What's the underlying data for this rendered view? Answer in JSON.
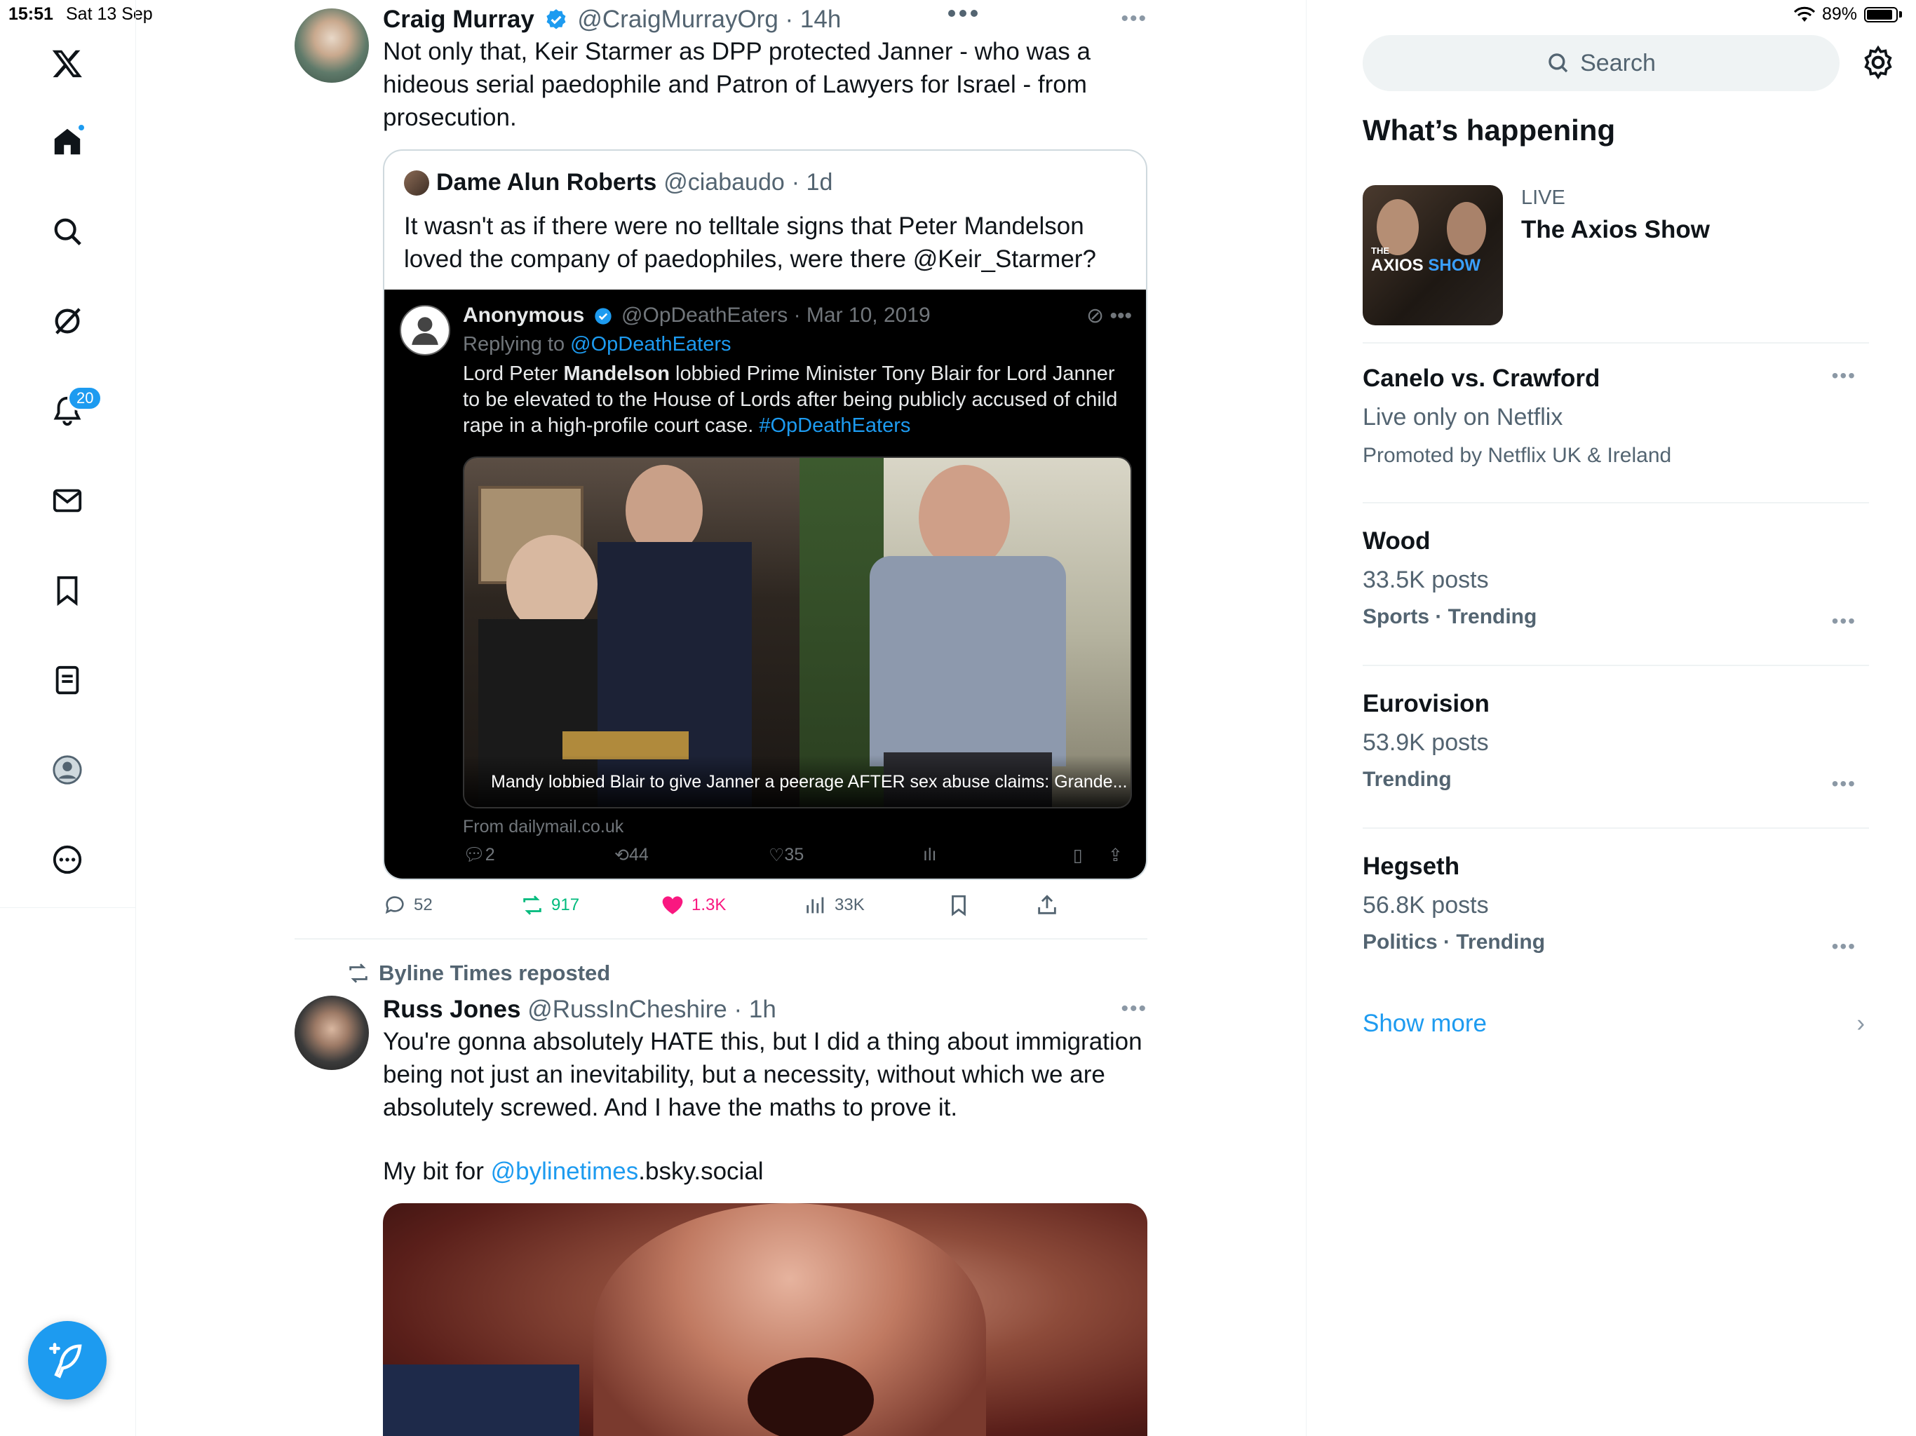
{
  "status": {
    "time": "15:51",
    "date": "Sat 13 Sep",
    "battery": "89%"
  },
  "nav": {
    "notifications_badge": "20"
  },
  "tweet1": {
    "name": "Craig Murray",
    "handle": "@CraigMurrayOrg",
    "time": "· 14h",
    "text": "Not only that, Keir Starmer as DPP protected Janner - who was a hideous serial paedophile and Patron of Lawyers for Israel - from prosecution.",
    "quote": {
      "name": "Dame Alun Roberts",
      "handle": "@ciabaudo",
      "time": "· 1d",
      "text": "It wasn't as if there were no telltale signs that Peter Mandelson loved the company of paedophiles, were there @Keir_Starmer?",
      "screenshot": {
        "name": "Anonymous",
        "handle": "@OpDeathEaters",
        "time": "· Mar 10, 2019",
        "replying_prefix": "Replying to",
        "replying_to": "@OpDeathEaters",
        "text_a": "Lord Peter",
        "text_bold": "Mandelson",
        "text_b": "lobbied Prime Minister Tony Blair for Lord Janner to be elevated to the House of Lords after being publicly accused of child rape in a high-profile court case.",
        "hashtag": "#OpDeathEaters",
        "caption": "Mandy lobbied Blair to give Janner a peerage AFTER sex abuse claims: Grande...",
        "from": "From dailymail.co.uk",
        "replies": "2",
        "reposts": "44",
        "likes": "35"
      }
    },
    "replies": "52",
    "reposts": "917",
    "likes": "1.3K",
    "views": "33K"
  },
  "tweet2": {
    "repost_by": "Byline Times reposted",
    "name": "Russ Jones",
    "handle": "@RussInCheshire",
    "time": "· 1h",
    "text": "You're gonna absolutely HATE this, but I did a thing about immigration being not just an inevitability, but a necessity, without which we are absolutely screwed. And I have the maths to prove it.",
    "text2_prefix": "My bit for",
    "text2_link": "@bylinetimes",
    "text2_suffix": ".bsky.social"
  },
  "right": {
    "search_placeholder": "Search",
    "title": "What’s happening",
    "live": {
      "label": "LIVE",
      "title": "The Axios Show",
      "thumb_small": "THE",
      "thumb_a": "AXIOS",
      "thumb_b": "SHOW"
    },
    "trends": [
      {
        "title": "Canelo vs. Crawford",
        "sub": "Live only on Netflix",
        "meta": "Promoted by Netflix UK & Ireland"
      },
      {
        "title": "Wood",
        "sub": "33.5K posts",
        "meta": "Sports · Trending"
      },
      {
        "title": "Eurovision",
        "sub": "53.9K posts",
        "meta": "Trending"
      },
      {
        "title": "Hegseth",
        "sub": "56.8K posts",
        "meta": "Politics · Trending"
      }
    ],
    "show_more": "Show more"
  },
  "colors": {
    "accent": "#1d9bf0",
    "like": "#f91880",
    "repost": "#00ba7c"
  }
}
